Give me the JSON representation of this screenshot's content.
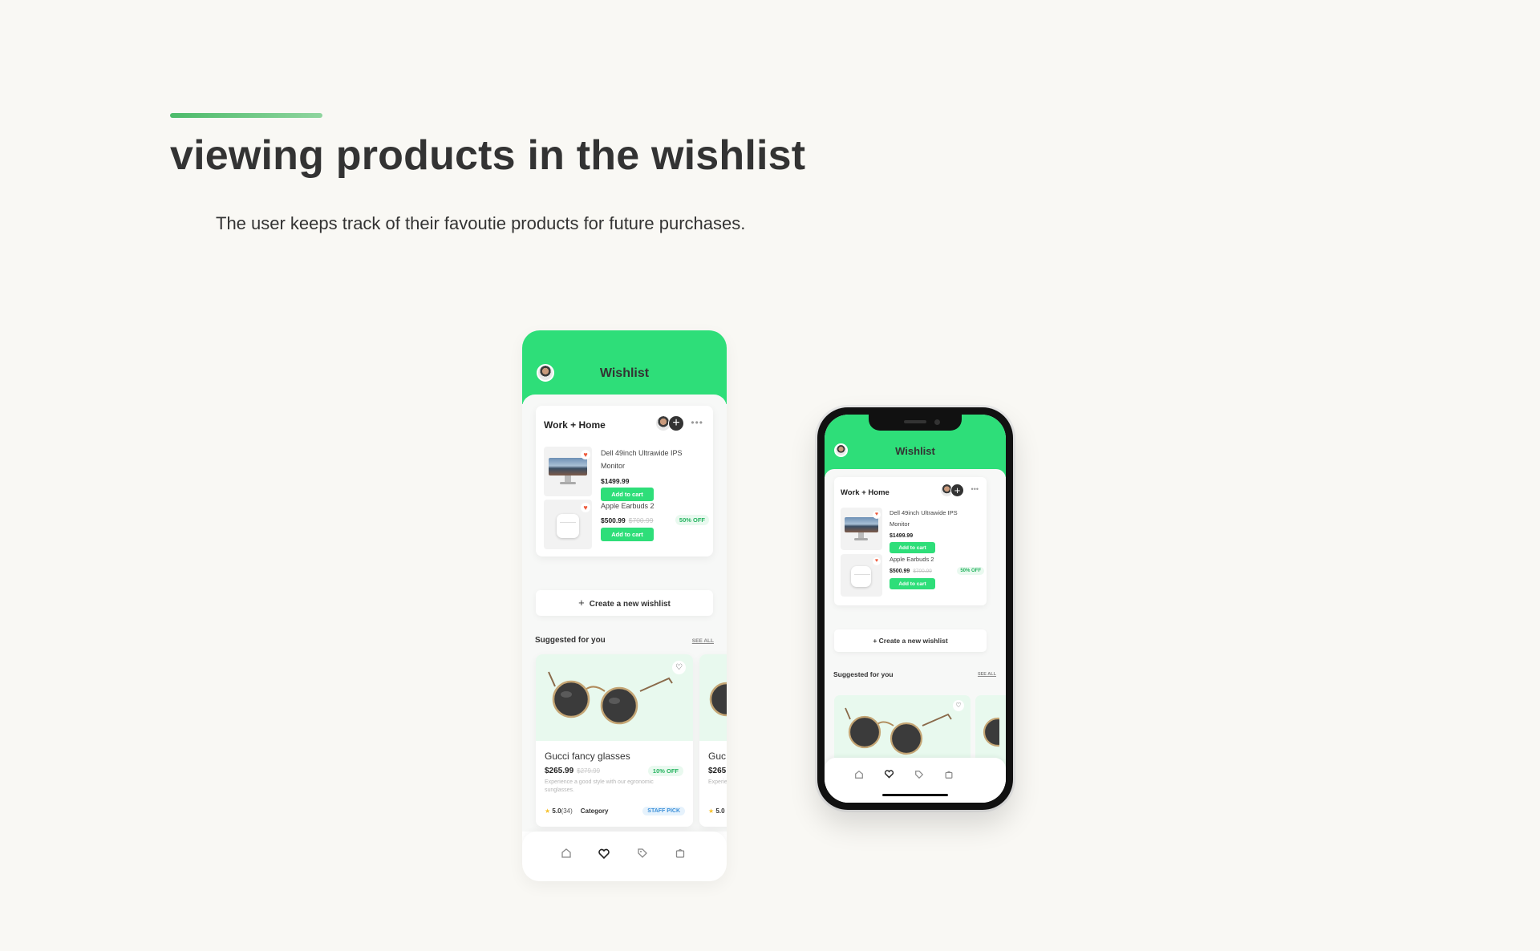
{
  "page": {
    "title": "viewing products in the wishlist",
    "subtitle": "The user keeps track of their favoutie products for future purchases."
  },
  "colors": {
    "brand_green": "#2ede79",
    "accent_line": "#4cbb6a",
    "heart": "#ef5a3b",
    "discount_green": "#25b35f",
    "staff_blue": "#3a8fd8"
  },
  "app": {
    "header_title": "Wishlist",
    "wishlist": {
      "name": "Work + Home",
      "more_icon": "more-horizontal-icon",
      "items": [
        {
          "name": "Dell 49inch Ultrawide IPS Monitor",
          "price": "$1499.99",
          "old_price": "",
          "discount": "",
          "add_label": "Add to cart",
          "favorited": true
        },
        {
          "name": "Apple Earbuds 2",
          "price": "$500.99",
          "old_price": "$700.99",
          "discount": "50% OFF",
          "add_label": "Add to cart",
          "favorited": true
        }
      ]
    },
    "create_wishlist_label": "Create a new wishlist",
    "suggested": {
      "title": "Suggested for you",
      "see_all": "SEE ALL",
      "products": [
        {
          "name": "Gucci fancy glasses",
          "price": "$265.99",
          "old_price": "$279.99",
          "discount": "10% OFF",
          "description": "Experience a good style with our egronomic sunglasses.",
          "rating": "5.0",
          "rating_count": "(34)",
          "category": "Category",
          "badge": "STAFF PICK"
        },
        {
          "name": "Guc",
          "price": "$265",
          "old_price": "",
          "discount": "",
          "description": "Experie sungla",
          "rating": "5.0",
          "rating_count": "",
          "category": "",
          "badge": ""
        }
      ]
    },
    "tabs": [
      "home-icon",
      "heart-icon",
      "tag-icon",
      "bag-icon"
    ],
    "active_tab": "heart-icon"
  }
}
